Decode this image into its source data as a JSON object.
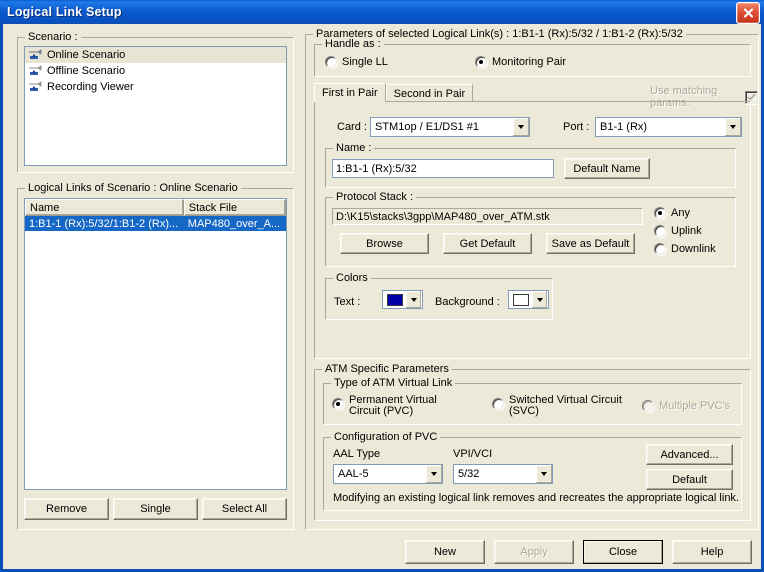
{
  "window": {
    "title": "Logical Link Setup",
    "close_label": "Close window",
    "titlebar_color": "#0a5bd3",
    "face_color": "#ece9d8"
  },
  "scenario": {
    "legend": "Scenario :",
    "items": [
      {
        "label": "Online Scenario",
        "selected": true
      },
      {
        "label": "Offline Scenario",
        "selected": false
      },
      {
        "label": "Recording Viewer",
        "selected": false
      }
    ]
  },
  "logical_links": {
    "legend": "Logical Links of Scenario : Online Scenario",
    "columns": [
      "Name",
      "Stack File"
    ],
    "rows": [
      {
        "name": "1:B1-1 (Rx):5/32/1:B1-2 (Rx)...",
        "stack_file": "MAP480_over_A...",
        "selected": true
      }
    ],
    "buttons": [
      {
        "label": "Remove",
        "enabled": true
      },
      {
        "label": "Single",
        "enabled": true
      },
      {
        "label": "Select All",
        "enabled": true
      }
    ]
  },
  "parameters": {
    "legend": "Parameters of selected Logical Link(s) : 1:B1-1 (Rx):5/32 / 1:B1-2 (Rx):5/32",
    "handle_as": {
      "legend": "Handle as :",
      "options": [
        {
          "label": "Single LL",
          "selected": false
        },
        {
          "label": "Monitoring Pair",
          "selected": true
        }
      ]
    },
    "tabs": [
      {
        "label": "First in Pair",
        "active": true
      },
      {
        "label": "Second in Pair",
        "active": false
      }
    ],
    "use_matching": {
      "label": "Use matching params.",
      "checked": true,
      "enabled": false
    },
    "card": {
      "label": "Card :",
      "value": "STM1op / E1/DS1 #1"
    },
    "port": {
      "label": "Port :",
      "value": "B1-1 (Rx)"
    },
    "name": {
      "legend": "Name :",
      "value": "1:B1-1 (Rx):5/32",
      "default_button": "Default Name"
    },
    "protocol_stack": {
      "legend": "Protocol Stack :",
      "value": "D:\\K15\\stacks\\3gpp\\MAP480_over_ATM.stk",
      "buttons": [
        {
          "label": "Browse"
        },
        {
          "label": "Get Default"
        },
        {
          "label": "Save as Default"
        }
      ],
      "direction": [
        {
          "label": "Any",
          "selected": true
        },
        {
          "label": "Uplink",
          "selected": false
        },
        {
          "label": "Downlink",
          "selected": false
        }
      ]
    },
    "colors": {
      "legend": "Colors",
      "text_label": "Text :",
      "text_color": "#0000a8",
      "background_label": "Background :",
      "background_color": "#ffffff"
    }
  },
  "atm": {
    "legend": "ATM Specific Parameters",
    "type_group": {
      "legend": "Type of ATM Virtual Link",
      "options": [
        {
          "label": "Permanent Virtual Circuit (PVC)",
          "selected": true,
          "enabled": true
        },
        {
          "label": "Switched Virtual Circuit (SVC)",
          "selected": false,
          "enabled": true
        },
        {
          "label": "Multiple PVC's",
          "selected": false,
          "enabled": false
        }
      ]
    },
    "pvc_config": {
      "legend": "Configuration of PVC",
      "aal_label": "AAL Type",
      "aal_value": "AAL-5",
      "vpi_label": "VPI/VCI",
      "vpi_value": "5/32",
      "buttons": [
        {
          "label": "Advanced..."
        },
        {
          "label": "Default"
        }
      ],
      "note": "Modifying an existing logical link removes and recreates the appropriate logical link."
    }
  },
  "footer": {
    "buttons": [
      {
        "label": "New",
        "enabled": true,
        "default": false
      },
      {
        "label": "Apply",
        "enabled": false,
        "default": false
      },
      {
        "label": "Close",
        "enabled": true,
        "default": true
      },
      {
        "label": "Help",
        "enabled": true,
        "default": false
      }
    ]
  }
}
